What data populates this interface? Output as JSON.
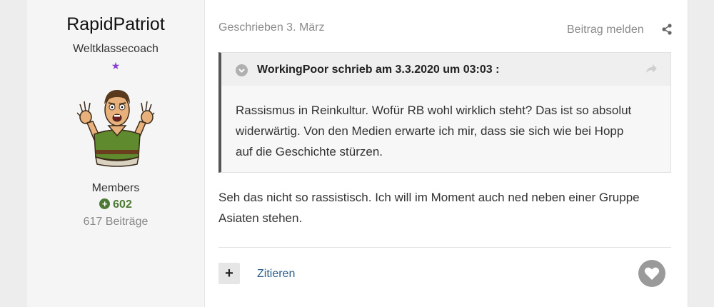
{
  "author": {
    "username": "RapidPatriot",
    "title": "Weltklassecoach",
    "rank_star": "★",
    "group": "Members",
    "reputation": "602",
    "post_count": "617 Beiträge"
  },
  "post": {
    "date": "Geschrieben 3. März",
    "report_label": "Beitrag melden",
    "quote": {
      "citation": "WorkingPoor schrieb am 3.3.2020 um 03:03 :",
      "text": "Rassismus in Reinkultur. Wofür RB wohl wirklich steht? Das ist so absolut widerwärtig. Von den Medien erwarte ich mir, dass sie sich wie bei Hopp auf die Geschichte stürzen."
    },
    "body": "Seh das nicht so rassistisch. Ich will im Moment auch ned neben einer Gruppe Asiaten stehen."
  },
  "actions": {
    "multiquote_label": "+",
    "quote_label": "Zitieren"
  },
  "icons": {
    "share": "share-icon",
    "toggle": "chevron-down-icon",
    "goto": "forward-arrow-icon",
    "like": "heart-icon",
    "reputation": "plus-circle-icon"
  },
  "colors": {
    "reputation_green": "#4c7a34",
    "link_blue": "#2d5f8a",
    "rank_purple": "#8a3fd1"
  }
}
